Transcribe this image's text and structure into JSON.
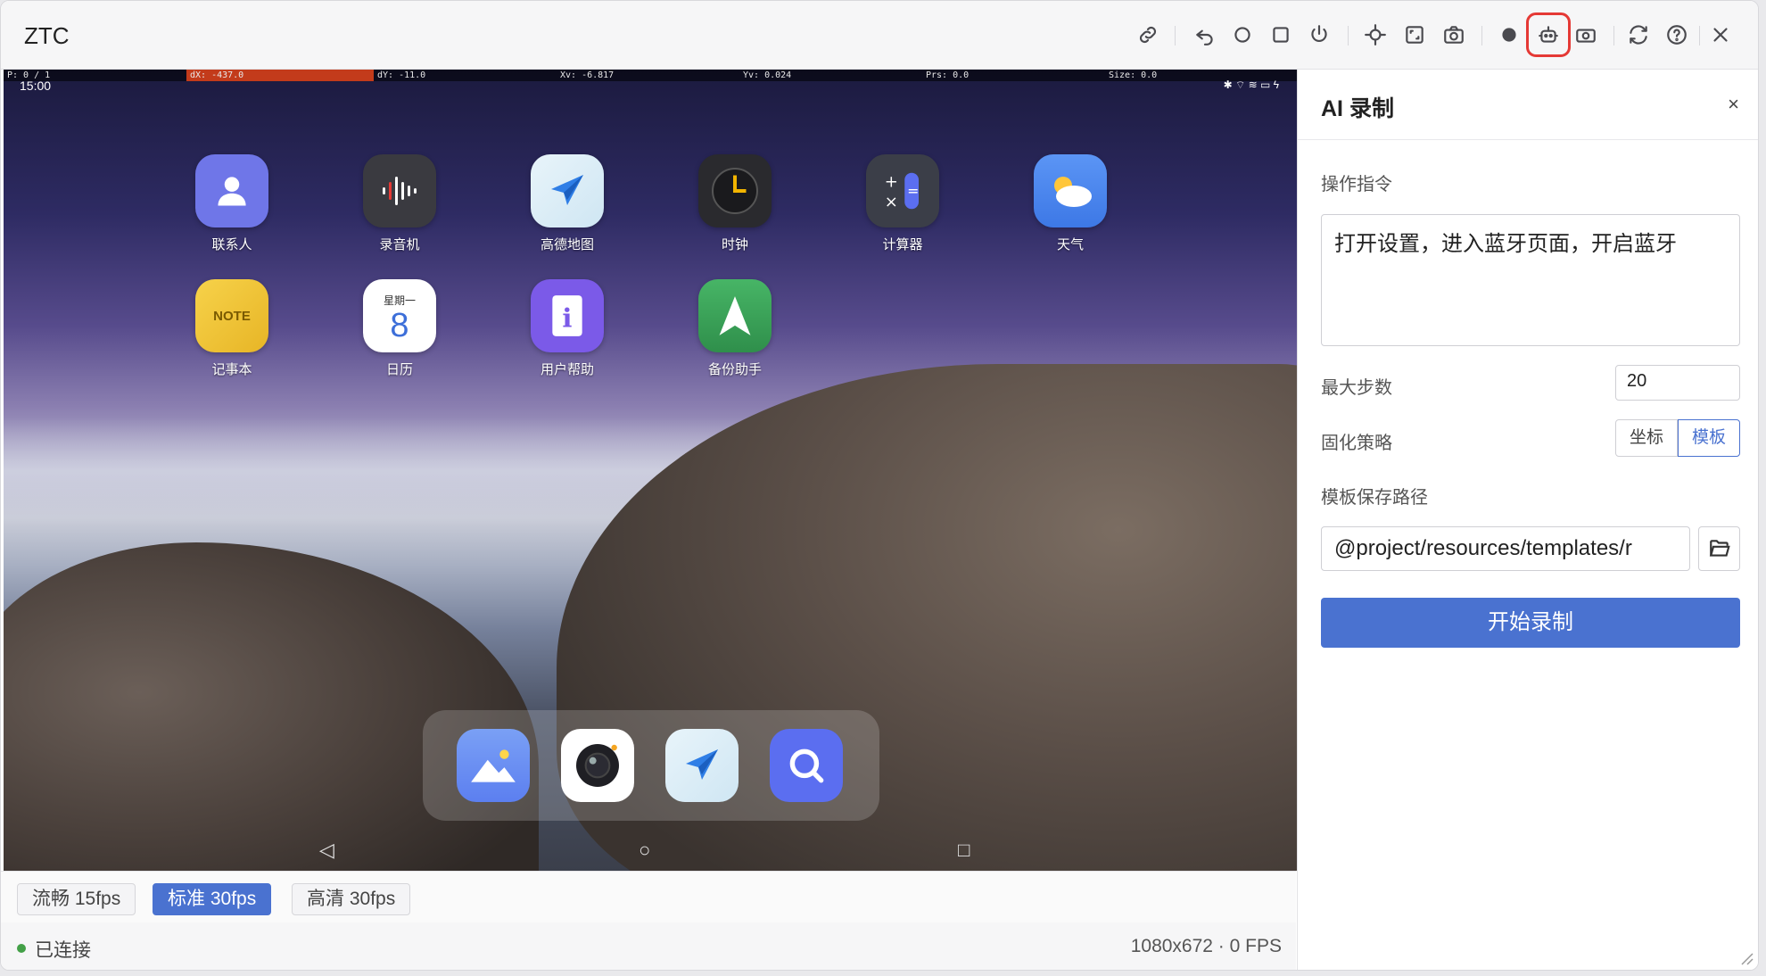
{
  "window": {
    "title": "ZTC"
  },
  "toolbar": {
    "icons": [
      "link-icon",
      "undo-icon",
      "circle-icon",
      "square-icon",
      "power-icon",
      "crosshair-icon",
      "expand-icon",
      "camera-icon",
      "record-dot-icon",
      "robot-icon",
      "screenshot-icon",
      "sync-icon",
      "help-icon",
      "close-icon"
    ],
    "highlight_color": "#e53935"
  },
  "device": {
    "debug": {
      "p": "P: 0 / 1",
      "dx": "dX: -437.0",
      "dy": "dY: -11.0",
      "xv": "Xv: -6.817",
      "yv": "Yv: 0.024",
      "prs": "Prs: 0.0",
      "size": "Size: 0.0"
    },
    "time": "15:00",
    "status_icons": "✱ ⌔ ≋ ▭ ϟ",
    "apps": [
      {
        "label": "联系人",
        "glyph": "👤",
        "bg": "#6f76e8"
      },
      {
        "label": "录音机",
        "glyph": "▮▯▮",
        "bg": "#3a3a40"
      },
      {
        "label": "高德地图",
        "glyph": "➤",
        "bg": "#e9f2f8"
      },
      {
        "label": "时钟",
        "glyph": "◷",
        "bg": "#2a2a2e"
      },
      {
        "label": "计算器",
        "glyph": "±",
        "bg": "#3b3e48"
      },
      {
        "label": "天气",
        "glyph": "☁",
        "bg": "#4d8af0"
      },
      {
        "label": "记事本",
        "glyph": "✎",
        "bg": "#f1c232"
      },
      {
        "label": "日历",
        "glyph": "8",
        "bg": "#ffffff"
      },
      {
        "label": "用户帮助",
        "glyph": "i",
        "bg": "#7b5ae8"
      },
      {
        "label": "备份助手",
        "glyph": "▲",
        "bg": "#3fa55a"
      }
    ],
    "calendar_weekday": "星期一",
    "note_text": "NOTE",
    "dock": [
      {
        "glyph": "⛰",
        "bg": "#6b8df0"
      },
      {
        "glyph": "◉",
        "bg": "#ffffff"
      },
      {
        "glyph": "➤",
        "bg": "#e9f2f8"
      },
      {
        "glyph": "⌕",
        "bg": "#5b6ef0"
      }
    ],
    "nav": {
      "back": "◁",
      "home": "○",
      "recent": "□"
    }
  },
  "fps": {
    "options": [
      {
        "label": "流畅 15fps",
        "active": false
      },
      {
        "label": "标准 30fps",
        "active": true
      },
      {
        "label": "高清 30fps",
        "active": false
      }
    ]
  },
  "status": {
    "connection": "已连接",
    "resolution": "1080x672 · 0 FPS",
    "connected_color": "#43a047"
  },
  "panel": {
    "title": "AI 录制",
    "close": "×",
    "instruction_label": "操作指令",
    "instruction_value": "打开设置，进入蓝牙页面，开启蓝牙",
    "max_steps_label": "最大步数",
    "max_steps_value": "20",
    "strategy_label": "固化策略",
    "strategy_options": [
      "坐标",
      "模板"
    ],
    "strategy_selected": "模板",
    "path_label": "模板保存路径",
    "path_value": "@project/resources/templates/r",
    "start_button": "开始录制",
    "accent": "#4a72d0"
  }
}
